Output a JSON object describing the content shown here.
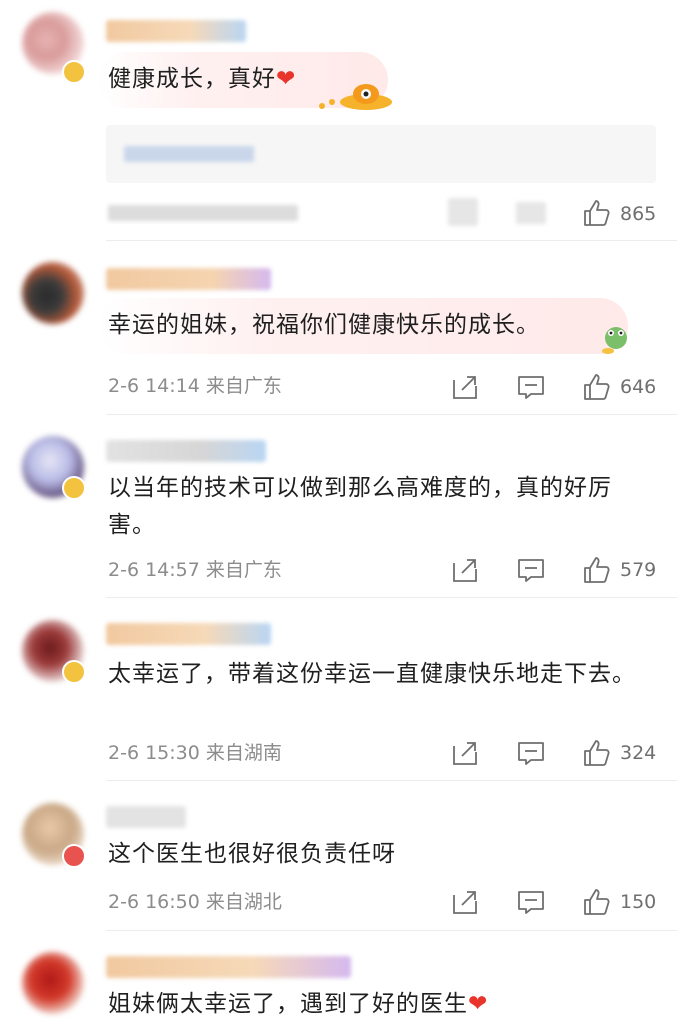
{
  "comments": [
    {
      "text": "健康成长，真好",
      "has_heart": true,
      "meta": "",
      "likes": "865"
    },
    {
      "text": "幸运的姐妹，祝福你们健康快乐的成长。",
      "has_heart": false,
      "meta": "2-6 14:14 来自广东",
      "likes": "646"
    },
    {
      "text": "以当年的技术可以做到那么高难度的，真的好厉害。",
      "has_heart": false,
      "meta": "2-6 14:57 来自广东",
      "likes": "579"
    },
    {
      "text": "太幸运了，带着这份幸运一直健康快乐地走下去。",
      "has_heart": false,
      "meta": "2-6 15:30 来自湖南",
      "likes": "324"
    },
    {
      "text": "这个医生也很好很负责任呀",
      "has_heart": false,
      "meta": "2-6 16:50 来自湖北",
      "likes": "150"
    },
    {
      "text": "姐妹俩太幸运了，遇到了好的医生",
      "has_heart": true,
      "meta": "",
      "likes": ""
    }
  ],
  "icons": {
    "share": "share-icon",
    "comment": "comment-icon",
    "like": "thumbs-up-icon",
    "heart": "heart-icon"
  },
  "colors": {
    "heart": "#e8342a",
    "meta": "#8c8c8c",
    "bubble": "#ffeaea"
  }
}
